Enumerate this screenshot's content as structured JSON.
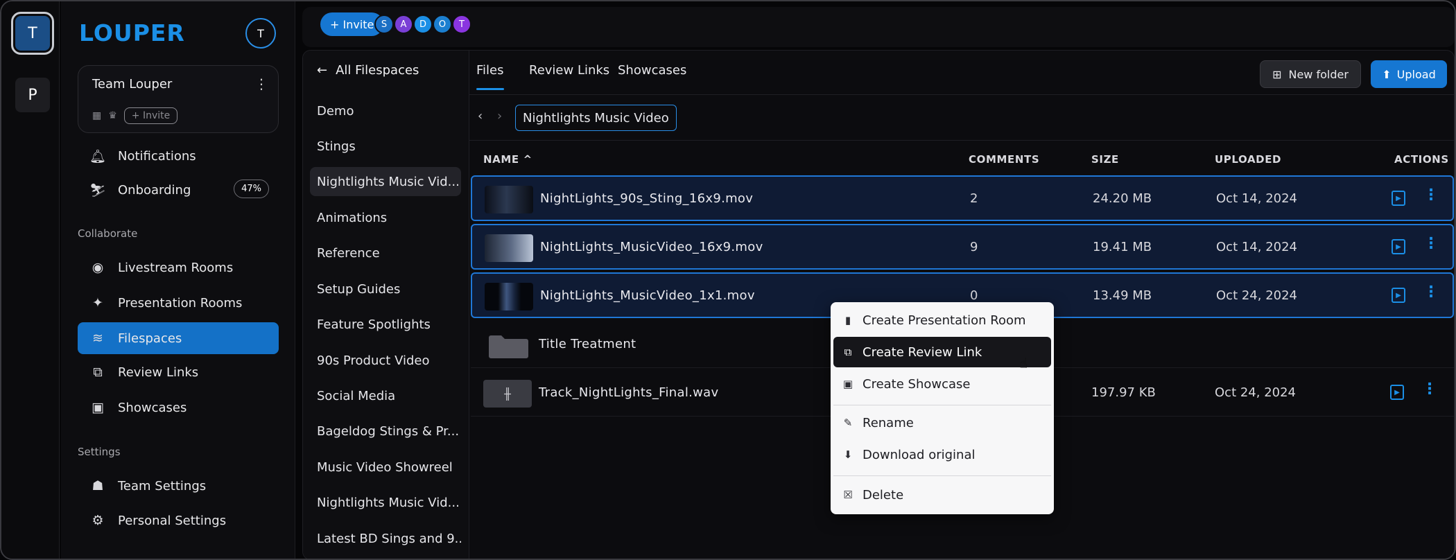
{
  "workspaces": [
    {
      "initial": "T",
      "active": true
    },
    {
      "initial": "P",
      "active": false
    }
  ],
  "sidebar": {
    "logo": "LOUPER",
    "user_initial": "T",
    "team": {
      "name": "Team Louper",
      "invite_label": "+ Invite"
    },
    "items": [
      {
        "label": "Notifications",
        "icon": "bell-icon"
      },
      {
        "label": "Onboarding",
        "icon": "onboarding-icon",
        "badge": "47%"
      }
    ],
    "collaborate_label": "Collaborate",
    "collaborate": [
      {
        "label": "Livestream Rooms",
        "icon": "livestream-icon"
      },
      {
        "label": "Presentation Rooms",
        "icon": "presentation-icon"
      },
      {
        "label": "Filespaces",
        "icon": "layers-icon",
        "active": true
      },
      {
        "label": "Review Links",
        "icon": "review-link-icon"
      },
      {
        "label": "Showcases",
        "icon": "showcase-icon"
      }
    ],
    "settings_label": "Settings",
    "settings": [
      {
        "label": "Team Settings",
        "icon": "team-icon"
      },
      {
        "label": "Personal Settings",
        "icon": "user-gear-icon"
      }
    ]
  },
  "topbar": {
    "invite_label": "+ Invite",
    "members": [
      {
        "initial": "S",
        "color": "#1b6fc4"
      },
      {
        "initial": "A",
        "color": "#7a3fd6"
      },
      {
        "initial": "D",
        "color": "#1b8fe6"
      },
      {
        "initial": "O",
        "color": "#1b7fd0"
      },
      {
        "initial": "T",
        "color": "#8a35e0"
      }
    ]
  },
  "filespaces": {
    "back_label": "All Filespaces",
    "items": [
      "Demo",
      "Stings",
      "Nightlights Music Vid...",
      "Animations",
      "Reference",
      "Setup Guides",
      "Feature Spotlights",
      "90s Product Video",
      "Social Media",
      "Bageldog Stings & Pr...",
      "Music Video Showreel",
      "Nightlights Music Vid...",
      "Latest BD Sings and 9..."
    ],
    "selected_index": 2
  },
  "files": {
    "tabs": [
      "Files",
      "Review Links",
      "Showcases"
    ],
    "new_folder_label": "New folder",
    "upload_label": "Upload",
    "breadcrumb": "Nightlights Music Video",
    "columns": {
      "name": "NAME",
      "comments": "COMMENTS",
      "size": "SIZE",
      "uploaded": "UPLOADED",
      "actions": "ACTIONS"
    },
    "rows": [
      {
        "name": "NightLights_90s_Sting_16x9.mov",
        "comments": "2",
        "size": "24.20 MB",
        "uploaded": "Oct 14, 2024",
        "selected": true,
        "thumb": "video"
      },
      {
        "name": "NightLights_MusicVideo_16x9.mov",
        "comments": "9",
        "size": "19.41 MB",
        "uploaded": "Oct 14, 2024",
        "selected": true,
        "thumb": "video"
      },
      {
        "name": "NightLights_MusicVideo_1x1.mov",
        "comments": "0",
        "size": "13.49 MB",
        "uploaded": "Oct 24, 2024",
        "selected": true,
        "thumb": "video"
      },
      {
        "name": "Title Treatment",
        "comments": "",
        "size": "",
        "uploaded": "",
        "selected": false,
        "thumb": "folder"
      },
      {
        "name": "Track_NightLights_Final.wav",
        "comments": "",
        "size": "197.97 KB",
        "uploaded": "Oct 24, 2024",
        "selected": false,
        "thumb": "audio"
      }
    ]
  },
  "context_menu": {
    "items": [
      {
        "label": "Create Presentation Room",
        "icon": "door-icon"
      },
      {
        "label": "Create Review Link",
        "icon": "review-link-icon",
        "hovered": true
      },
      {
        "label": "Create Showcase",
        "icon": "camera-icon"
      },
      {
        "label": "Rename",
        "icon": "pencil-icon"
      },
      {
        "label": "Download original",
        "icon": "download-icon"
      },
      {
        "label": "Delete",
        "icon": "trash-icon"
      }
    ]
  },
  "colors": {
    "accent": "#1677d2",
    "selected_row_bg": "#0f1b34",
    "selected_row_border": "#1f77d6"
  }
}
